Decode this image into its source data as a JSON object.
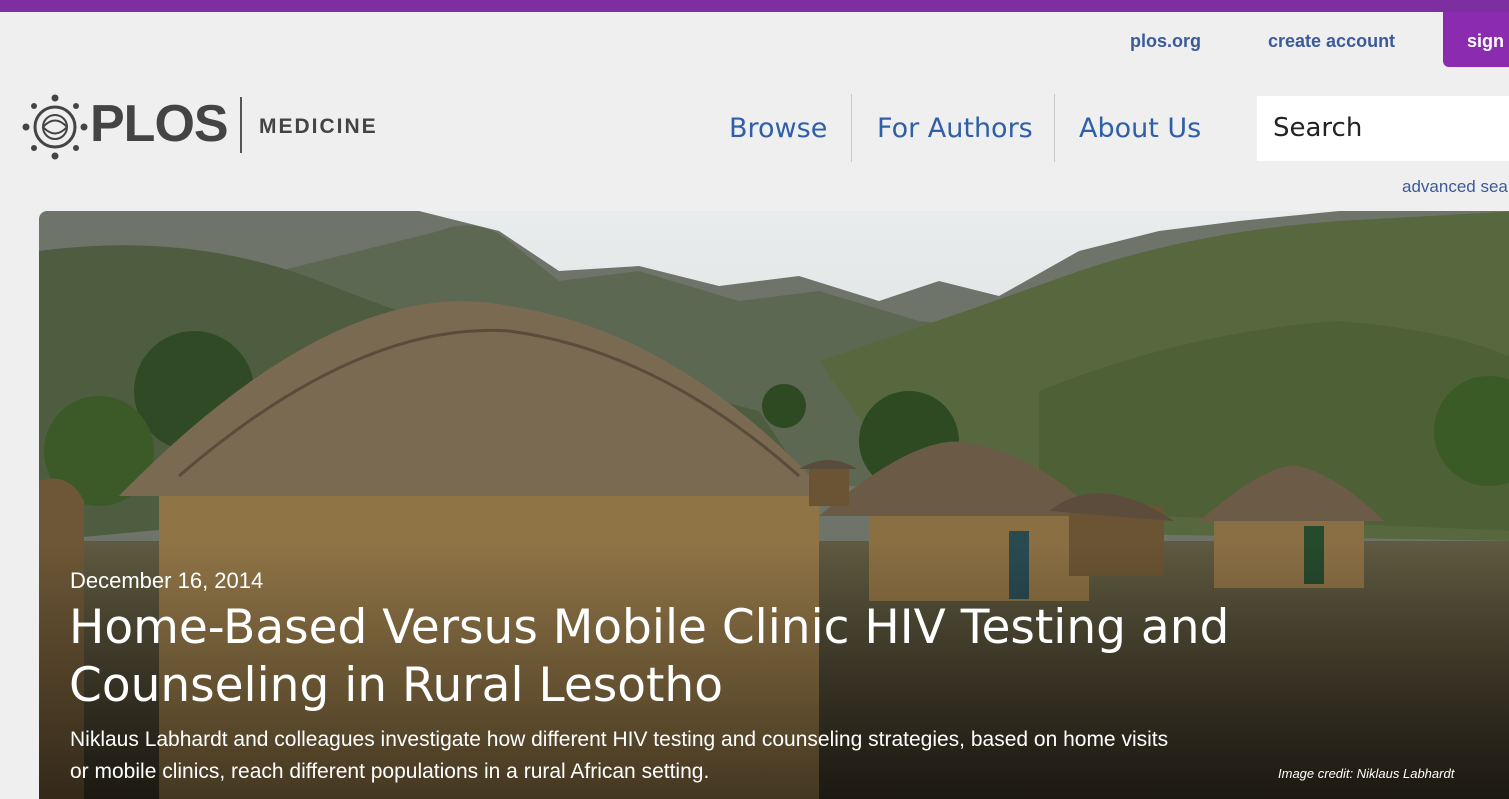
{
  "utility_nav": {
    "plos_org": "plos.org",
    "create_account": "create account",
    "sign_in": "sign in"
  },
  "logo": {
    "wordmark": "PLOS",
    "journal": "MEDICINE"
  },
  "main_nav": {
    "browse": "Browse",
    "for_authors": "For Authors",
    "about_us": "About Us"
  },
  "search": {
    "placeholder": "Search",
    "advanced": "advanced search"
  },
  "hero": {
    "date": "December 16, 2014",
    "title": "Home-Based Versus Mobile Clinic HIV Testing and Counseling in Rural Lesotho",
    "summary": "Niklaus Labhardt and colleagues investigate how different HIV testing and counseling strategies, based on home visits or mobile clinics, reach different populations in a rural African setting.",
    "image_credit": "Image credit: Niklaus Labhardt"
  },
  "colors": {
    "brand_purple": "#7d2ea0",
    "link_blue": "#2f5fa6"
  }
}
